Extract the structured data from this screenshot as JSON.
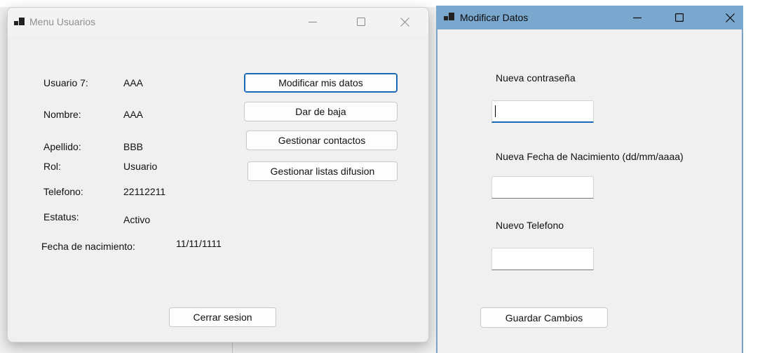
{
  "window_user_menu": {
    "title": "Menu Usuarios",
    "fields": [
      {
        "label": "Usuario 7:",
        "value": "AAA"
      },
      {
        "label": "Nombre:",
        "value": "AAA"
      },
      {
        "label": "Apellido:",
        "value": "BBB"
      },
      {
        "label": "Rol:",
        "value": "Usuario"
      },
      {
        "label": "Telefono:",
        "value": "22112211"
      },
      {
        "label": "Estatus:",
        "value": "Activo"
      },
      {
        "label": "Fecha de nacimiento:",
        "value": "11/11/1111"
      }
    ],
    "buttons": {
      "modify": "Modificar mis datos",
      "unsubscribe": "Dar de baja",
      "contacts": "Gestionar contactos",
      "broadcast_lists": "Gestionar listas difusion",
      "logout": "Cerrar sesion"
    }
  },
  "window_modify_data": {
    "title": "Modificar Datos",
    "new_password": {
      "label": "Nueva contraseña",
      "value": ""
    },
    "new_birthdate": {
      "label": "Nueva Fecha de Nacimiento (dd/mm/aaaa)",
      "value": ""
    },
    "new_phone": {
      "label": "Nuevo Telefono",
      "value": ""
    },
    "save_button": "Guardar Cambios"
  },
  "colors": {
    "active_titlebar": "#7aa7cd",
    "focus_accent": "#1b69b6",
    "window_bg": "#f0f0f0"
  },
  "icons": [
    "app-icon",
    "minimize-icon",
    "maximize-icon",
    "close-icon"
  ]
}
